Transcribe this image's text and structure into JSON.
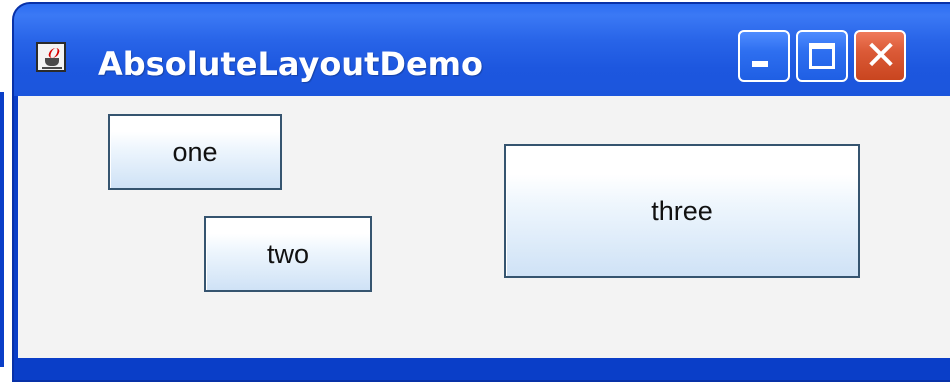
{
  "window": {
    "title": "AbsoluteLayoutDemo",
    "icon": "java-coffee-cup-icon",
    "controls": {
      "minimize": "minimize-icon",
      "maximize": "maximize-icon",
      "close": "close-icon",
      "close_glyph": "✕"
    }
  },
  "buttons": {
    "one": "one",
    "two": "two",
    "three": "three"
  },
  "colors": {
    "titlebar": "#1d57df",
    "content_background": "#f3f3f3",
    "button_border": "#35546f",
    "close_button": "#c9451f"
  }
}
